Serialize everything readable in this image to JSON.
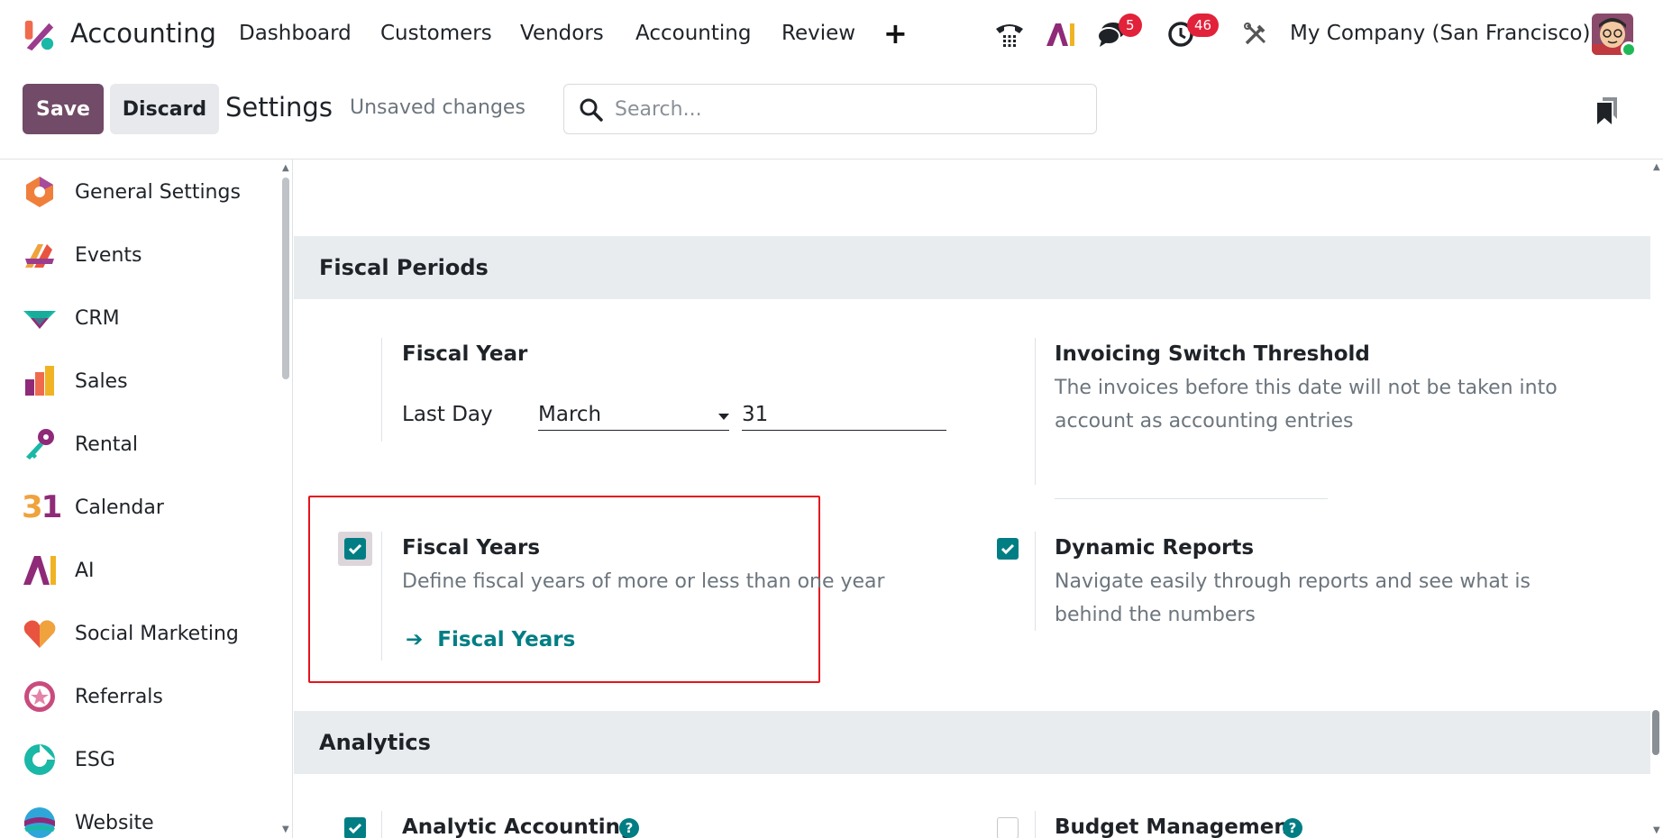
{
  "app": {
    "name": "Accounting"
  },
  "navbar": {
    "items": [
      "Dashboard",
      "Customers",
      "Vendors",
      "Accounting",
      "Review"
    ],
    "add_label": "+",
    "ai_label": "AI",
    "messages_badge": "5",
    "activities_badge": "46",
    "company": "My Company (San Francisco)"
  },
  "control_panel": {
    "save_label": "Save",
    "discard_label": "Discard",
    "title": "Settings",
    "unsaved": "Unsaved changes",
    "search_placeholder": "Search..."
  },
  "sidebar": {
    "items": [
      {
        "label": "General Settings",
        "icon": "general-settings-icon"
      },
      {
        "label": "Events",
        "icon": "events-icon"
      },
      {
        "label": "CRM",
        "icon": "crm-icon"
      },
      {
        "label": "Sales",
        "icon": "sales-icon"
      },
      {
        "label": "Rental",
        "icon": "rental-icon"
      },
      {
        "label": "Calendar",
        "icon": "calendar-icon"
      },
      {
        "label": "AI",
        "icon": "ai-icon"
      },
      {
        "label": "Social Marketing",
        "icon": "social-marketing-icon"
      },
      {
        "label": "Referrals",
        "icon": "referrals-icon"
      },
      {
        "label": "ESG",
        "icon": "esg-icon"
      },
      {
        "label": "Website",
        "icon": "website-icon"
      }
    ],
    "calendar_glyph": "31"
  },
  "fiscal_periods": {
    "title": "Fiscal Periods",
    "fiscal_year": {
      "title": "Fiscal Year",
      "last_day_label": "Last Day",
      "month": "March",
      "day": "31"
    },
    "invoicing_threshold": {
      "title": "Invoicing Switch Threshold",
      "desc_line1": "The invoices before this date will not be taken into",
      "desc_line2": "account as accounting entries"
    },
    "fiscal_years": {
      "title": "Fiscal Years",
      "desc": "Define fiscal years of more or less than one year",
      "link": "Fiscal Years",
      "checked": true
    },
    "dynamic_reports": {
      "title": "Dynamic Reports",
      "desc_line1": "Navigate easily through reports and see what is",
      "desc_line2": "behind the numbers",
      "checked": true
    }
  },
  "analytics": {
    "title": "Analytics",
    "analytic_accounting": {
      "title": "Analytic Accounting",
      "checked": true
    },
    "budget_management": {
      "title": "Budget Management",
      "checked": false
    },
    "help_glyph": "?"
  },
  "colors": {
    "brand": "#714b67",
    "accent": "#017e84",
    "badge": "#e2213a",
    "highlight": "#e4141c"
  }
}
